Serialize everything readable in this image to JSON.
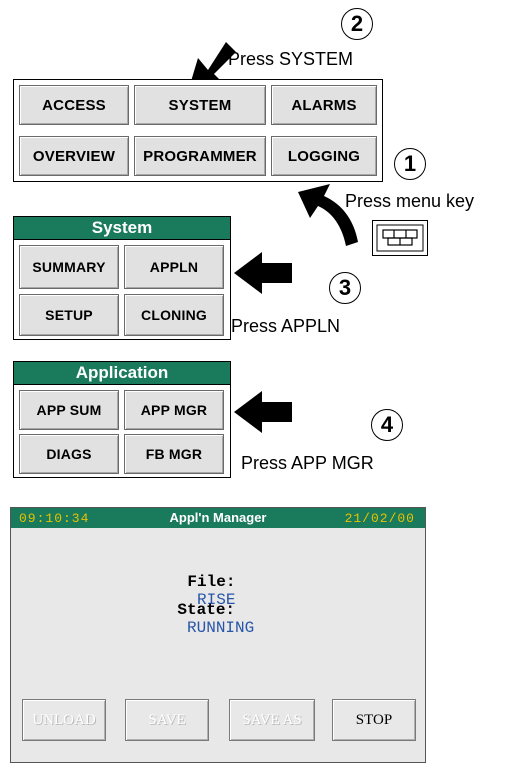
{
  "steps": {
    "step1": {
      "number": "1",
      "caption": "Press menu key"
    },
    "step2": {
      "number": "2",
      "caption": "Press SYSTEM"
    },
    "step3": {
      "number": "3",
      "caption": "Press APPLN"
    },
    "step4": {
      "number": "4",
      "caption": "Press APP MGR"
    }
  },
  "main_menu": {
    "buttons": [
      "ACCESS",
      "SYSTEM",
      "ALARMS",
      "OVERVIEW",
      "PROGRAMMER",
      "LOGGING"
    ]
  },
  "system_menu": {
    "title": "System",
    "buttons": [
      "SUMMARY",
      "APPLN",
      "SETUP",
      "CLONING"
    ]
  },
  "application_menu": {
    "title": "Application",
    "buttons": [
      "APP SUM",
      "APP MGR",
      "DIAGS",
      "FB MGR"
    ]
  },
  "appln_manager": {
    "time": "09:10:34",
    "title": "Appl'n Manager",
    "date": "21/02/00",
    "file_label": "File:",
    "file_value": "RISE",
    "state_label": "State:",
    "state_value": "RUNNING",
    "buttons": {
      "unload": "UNLOAD",
      "save": "SAVE",
      "save_as": "SAVE AS",
      "stop": "STOP"
    }
  },
  "colors": {
    "title_bar": "#1a7a5c",
    "clock": "#e7c200",
    "value_text": "#2755a8",
    "button_face": "#e1e1e1"
  }
}
